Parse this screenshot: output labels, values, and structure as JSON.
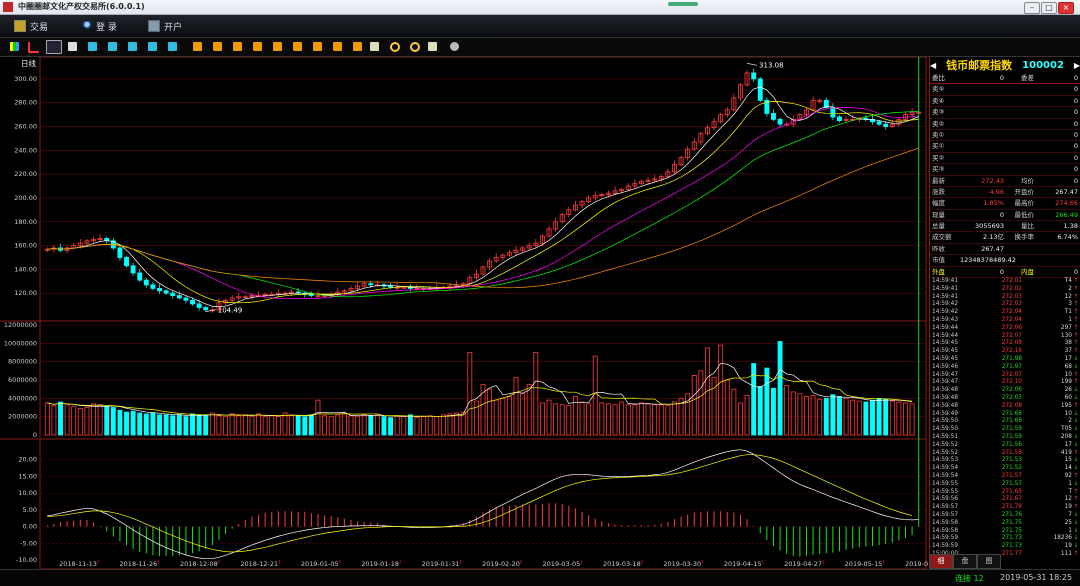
{
  "window": {
    "title": "中圈圈邮文化产权交易所(6.0.0.1)"
  },
  "menu": {
    "items": [
      {
        "label": "交易"
      },
      {
        "label": "登 录"
      },
      {
        "label": "开户"
      }
    ]
  },
  "chart": {
    "period_label": "日线",
    "price_y_ticks": [
      "300.00",
      "280.00",
      "260.00",
      "240.00",
      "220.00",
      "200.00",
      "180.00",
      "160.00",
      "140.00",
      "120.00"
    ],
    "volume_y_ticks": [
      "12000000",
      "10000000",
      "8000000",
      "6000000",
      "4000000",
      "2000000",
      "0"
    ],
    "macd_y_ticks": [
      "20.00",
      "15.00",
      "10.00",
      "5.00",
      "0.00",
      "-5.00",
      "-10.00"
    ],
    "x_dates": [
      "2018-11-13",
      "2018-11-26",
      "2018-12-08",
      "2018-12-21",
      "2019-01-05",
      "2019-01-18",
      "2019-01-31",
      "2019-02-20",
      "2019-03-05",
      "2019-03-18",
      "2019-03-30",
      "2019-04-15",
      "2019-04-27",
      "2019-05-15",
      "2019-05-31"
    ],
    "max_label": "313.08",
    "min_label": "104.49"
  },
  "chart_data": {
    "type": "candlestick",
    "price_ylim": [
      100,
      310
    ],
    "volume_ylim": [
      0,
      12000000
    ],
    "macd_ylim": [
      -10,
      25
    ],
    "max_price": 313.08,
    "min_price": 104.49,
    "close_series": [
      157,
      158,
      156,
      158,
      160,
      162,
      164,
      165,
      166,
      164,
      158,
      150,
      143,
      137,
      131,
      127,
      124,
      122,
      120,
      118,
      116,
      114,
      111,
      108,
      106,
      106,
      112,
      114,
      116,
      117,
      117,
      118,
      118,
      119,
      119,
      120,
      120,
      121,
      120,
      119,
      118,
      118,
      118,
      119,
      121,
      122,
      124,
      126,
      128,
      127,
      127,
      126,
      125,
      125,
      125,
      124,
      124,
      124,
      124,
      125,
      125,
      126,
      127,
      128,
      133,
      136,
      142,
      147,
      150,
      152,
      154,
      156,
      158,
      160,
      162,
      168,
      174,
      180,
      186,
      190,
      194,
      197,
      200,
      202,
      203,
      204,
      206,
      207,
      210,
      212,
      214,
      215,
      216,
      218,
      222,
      228,
      234,
      241,
      247,
      254,
      259,
      264,
      270,
      274,
      284,
      295,
      305,
      300,
      282,
      271,
      266,
      262,
      262,
      266,
      270,
      274,
      282,
      282,
      276,
      268,
      265,
      266,
      266,
      267,
      266,
      264,
      262,
      260,
      262,
      266,
      270,
      272,
      272
    ],
    "volume_series": [
      3500000,
      3200000,
      3600000,
      3300000,
      3100000,
      2900000,
      3000000,
      3400000,
      3300000,
      3100000,
      3000000,
      2700000,
      2500000,
      2600000,
      2400000,
      2300000,
      2400000,
      2200000,
      2200000,
      2100000,
      2200000,
      2000000,
      2300000,
      2100000,
      2200000,
      2400000,
      2100000,
      2000000,
      2300000,
      2100000,
      2200000,
      2000000,
      2300000,
      2000000,
      2100000,
      2000000,
      2400000,
      2200000,
      2100000,
      2000000,
      2200000,
      3800000,
      2100000,
      2000000,
      2200000,
      2300000,
      2100000,
      2000000,
      2200000,
      2100000,
      2200000,
      2000000,
      1900000,
      2100000,
      2000000,
      2200000,
      1900000,
      2000000,
      2100000,
      2000000,
      2200000,
      2300000,
      2400000,
      2500000,
      9000000,
      3700000,
      5500000,
      5000000,
      3800000,
      4000000,
      4200000,
      6300000,
      4500000,
      5500000,
      9000000,
      3500000,
      3800000,
      3400000,
      3300000,
      3200000,
      4200000,
      3600000,
      3400000,
      8600000,
      3500000,
      3400000,
      3300000,
      3600000,
      3300000,
      3300000,
      3500000,
      3400000,
      3300000,
      3300000,
      3200000,
      3600000,
      4000000,
      4500000,
      6500000,
      7000000,
      9500000,
      6300000,
      9800000,
      6000000,
      5000000,
      3500000,
      4300000,
      7800000,
      5300000,
      7300000,
      5100000,
      10200000,
      5400000,
      4700000,
      4500000,
      4200000,
      4300000,
      3900000,
      4000000,
      4400000,
      4200000,
      4000000,
      3800000,
      3700000,
      3600000,
      3800000,
      4000000,
      3900000,
      3700000,
      3600000,
      3500000,
      3400000
    ],
    "macd_dif": [
      3.2,
      3.5,
      4.0,
      4.4,
      4.8,
      5.2,
      5.5,
      5.3,
      4.6,
      3.8,
      2.7,
      1.5,
      0.3,
      -1.0,
      -2.2,
      -3.3,
      -4.4,
      -5.4,
      -6.3,
      -7.1,
      -7.8,
      -8.5,
      -9.0,
      -9.4,
      -9.6,
      -9.6,
      -9.2,
      -8.6,
      -7.9,
      -7.1,
      -6.3,
      -5.5,
      -4.8,
      -4.1,
      -3.5,
      -2.9,
      -2.4,
      -1.9,
      -1.5,
      -1.1,
      -0.8,
      -0.5,
      -0.3,
      -0.1,
      0.0,
      0.1,
      0.2,
      0.2,
      0.3,
      0.3,
      0.3,
      0.2,
      0.1,
      0.0,
      -0.1,
      -0.2,
      -0.3,
      -0.3,
      -0.3,
      -0.2,
      -0.1,
      0.1,
      0.3,
      0.6,
      1.3,
      2.2,
      3.3,
      4.5,
      5.6,
      6.6,
      7.6,
      8.6,
      9.6,
      10.5,
      11.4,
      12.4,
      13.4,
      14.3,
      15.0,
      15.4,
      15.6,
      15.6,
      15.5,
      15.3,
      15.1,
      15.0,
      14.9,
      14.9,
      15.0,
      15.1,
      15.2,
      15.3,
      15.5,
      15.7,
      16.2,
      16.9,
      17.7,
      18.5,
      19.3,
      20.0,
      20.7,
      21.3,
      21.9,
      22.4,
      22.8,
      23.0,
      22.6,
      21.6,
      20.3,
      18.9,
      17.5,
      16.1,
      14.8,
      13.6,
      12.6,
      11.8,
      11.1,
      10.3,
      9.5,
      8.7,
      8.0,
      7.3,
      6.6,
      5.9,
      5.2,
      4.5,
      3.8,
      3.2,
      2.7,
      2.3,
      2.1,
      2.0,
      2.1
    ],
    "macd_dea": [
      3.0,
      3.1,
      3.3,
      3.6,
      3.9,
      4.2,
      4.5,
      4.7,
      4.7,
      4.5,
      4.2,
      3.7,
      3.1,
      2.4,
      1.6,
      0.7,
      -0.1,
      -1.0,
      -1.9,
      -2.7,
      -3.5,
      -4.3,
      -5.0,
      -5.7,
      -6.3,
      -6.8,
      -7.2,
      -7.5,
      -7.6,
      -7.5,
      -7.3,
      -7.0,
      -6.6,
      -6.2,
      -5.7,
      -5.2,
      -4.7,
      -4.2,
      -3.7,
      -3.3,
      -2.8,
      -2.4,
      -2.0,
      -1.7,
      -1.4,
      -1.1,
      -0.8,
      -0.6,
      -0.4,
      -0.3,
      -0.2,
      -0.1,
      0.0,
      0.0,
      0.0,
      0.0,
      -0.1,
      -0.1,
      -0.1,
      -0.1,
      -0.1,
      -0.1,
      0.0,
      0.1,
      0.3,
      0.7,
      1.2,
      1.9,
      2.7,
      3.6,
      4.5,
      5.4,
      6.3,
      7.2,
      8.1,
      9.0,
      9.9,
      10.8,
      11.6,
      12.3,
      12.9,
      13.4,
      13.8,
      14.1,
      14.3,
      14.5,
      14.6,
      14.7,
      14.8,
      14.9,
      15.0,
      15.1,
      15.2,
      15.3,
      15.5,
      15.8,
      16.2,
      16.7,
      17.2,
      17.8,
      18.4,
      19.0,
      19.6,
      20.2,
      20.7,
      21.2,
      21.5,
      21.5,
      21.3,
      20.9,
      20.4,
      19.7,
      18.9,
      18.0,
      17.1,
      16.2,
      15.3,
      14.4,
      13.5,
      12.6,
      11.7,
      10.8,
      9.9,
      9.0,
      8.2,
      7.4,
      6.6,
      5.8,
      5.1,
      4.4,
      3.8,
      3.3
    ]
  },
  "quote": {
    "name": "钱币邮票指数",
    "code": "100002",
    "order_book": [
      {
        "l1": "委比",
        "v1": "0",
        "l2": "委差",
        "v2": "0"
      },
      {
        "l1": "卖⑤",
        "v1": "",
        "l2": "",
        "v2": "0"
      },
      {
        "l1": "卖④",
        "v1": "",
        "l2": "",
        "v2": "0"
      },
      {
        "l1": "卖③",
        "v1": "",
        "l2": "",
        "v2": "0"
      },
      {
        "l1": "卖②",
        "v1": "",
        "l2": "",
        "v2": "0"
      },
      {
        "l1": "卖①",
        "v1": "",
        "l2": "",
        "v2": "0"
      },
      {
        "l1": "买①",
        "v1": "",
        "l2": "",
        "v2": "0"
      },
      {
        "l1": "买②",
        "v1": "",
        "l2": "",
        "v2": "0"
      },
      {
        "l1": "买③",
        "v1": "",
        "l2": "",
        "v2": "0"
      }
    ],
    "stats": [
      {
        "l1": "最新",
        "v1": "272.43",
        "c1": "red",
        "l2": "均价",
        "v2": "0",
        "c2": "white"
      },
      {
        "l1": "涨跌",
        "v1": "4.96",
        "c1": "red",
        "l2": "开盘价",
        "v2": "267.47",
        "c2": "white"
      },
      {
        "l1": "幅度",
        "v1": "1.85%",
        "c1": "red",
        "l2": "最高价",
        "v2": "274.66",
        "c2": "red"
      },
      {
        "l1": "现量",
        "v1": "0",
        "c1": "white",
        "l2": "最低价",
        "v2": "266.49",
        "c2": "green"
      },
      {
        "l1": "总量",
        "v1": "3055693",
        "c1": "white",
        "l2": "量比",
        "v2": "1.38",
        "c2": "white"
      },
      {
        "l1": "成交额",
        "v1": "2.13亿",
        "c1": "white",
        "l2": "换手率",
        "v2": "6.74%",
        "c2": "white"
      },
      {
        "l1": "昨收",
        "v1": "267.47",
        "c1": "white",
        "l2": "",
        "v2": "",
        "c2": "white"
      },
      {
        "l1": "市值",
        "v1": "12348378489.42",
        "c1": "white",
        "l2": "",
        "v2": "",
        "c2": "white"
      }
    ],
    "outer_label": "外盘",
    "outer_value": "0",
    "inner_label": "内盘",
    "inner_value": "0"
  },
  "ticks": [
    {
      "t": "14:59:41",
      "p": "272.01",
      "v": "T4",
      "d": "up"
    },
    {
      "t": "14:59:41",
      "p": "272.02",
      "v": "2",
      "d": "up"
    },
    {
      "t": "14:59:41",
      "p": "272.03",
      "v": "12",
      "d": "up"
    },
    {
      "t": "14:59:42",
      "p": "272.03",
      "v": "3",
      "d": "up"
    },
    {
      "t": "14:59:42",
      "p": "272.04",
      "v": "T1",
      "d": "up"
    },
    {
      "t": "14:59:43",
      "p": "272.04",
      "v": "1",
      "d": "up"
    },
    {
      "t": "14:59:44",
      "p": "272.06",
      "v": "297",
      "d": "up"
    },
    {
      "t": "14:59:44",
      "p": "272.07",
      "v": "130",
      "d": "up"
    },
    {
      "t": "14:59:45",
      "p": "272.08",
      "v": "38",
      "d": "up"
    },
    {
      "t": "14:59:45",
      "p": "272.16",
      "v": "37",
      "d": "up"
    },
    {
      "t": "14:59:45",
      "p": "271.98",
      "v": "17",
      "d": "down"
    },
    {
      "t": "14:59:46",
      "p": "271.97",
      "v": "68",
      "d": "down"
    },
    {
      "t": "14:59:47",
      "p": "272.07",
      "v": "10",
      "d": "up"
    },
    {
      "t": "14:59:47",
      "p": "272.10",
      "v": "199",
      "d": "up"
    },
    {
      "t": "14:59:48",
      "p": "272.06",
      "v": "26",
      "d": "down"
    },
    {
      "t": "14:59:48",
      "p": "272.03",
      "v": "60",
      "d": "down"
    },
    {
      "t": "14:59:48",
      "p": "272.08",
      "v": "195",
      "d": "up"
    },
    {
      "t": "14:59:49",
      "p": "271.68",
      "v": "10",
      "d": "down"
    },
    {
      "t": "14:59:50",
      "p": "271.68",
      "v": "2",
      "d": "down"
    },
    {
      "t": "14:59:50",
      "p": "271.59",
      "v": "T05",
      "d": "down"
    },
    {
      "t": "14:59:51",
      "p": "271.59",
      "v": "208",
      "d": "down"
    },
    {
      "t": "14:59:52",
      "p": "271.56",
      "v": "17",
      "d": "down"
    },
    {
      "t": "14:59:52",
      "p": "271.58",
      "v": "419",
      "d": "up"
    },
    {
      "t": "14:59:53",
      "p": "271.53",
      "v": "15",
      "d": "down"
    },
    {
      "t": "14:59:54",
      "p": "271.52",
      "v": "14",
      "d": "down"
    },
    {
      "t": "14:59:54",
      "p": "271.57",
      "v": "92",
      "d": "up"
    },
    {
      "t": "14:59:55",
      "p": "271.57",
      "v": "1",
      "d": "down"
    },
    {
      "t": "14:59:55",
      "p": "271.65",
      "v": "T",
      "d": "up"
    },
    {
      "t": "14:59:56",
      "p": "271.67",
      "v": "12",
      "d": "up"
    },
    {
      "t": "14:59:57",
      "p": "271.78",
      "v": "19",
      "d": "up"
    },
    {
      "t": "14:59:57",
      "p": "271.76",
      "v": "7",
      "d": "down"
    },
    {
      "t": "14:59:58",
      "p": "271.75",
      "v": "25",
      "d": "down"
    },
    {
      "t": "14:59:58",
      "p": "271.75",
      "v": "1",
      "d": "down"
    },
    {
      "t": "14:59:59",
      "p": "271.73",
      "v": "18236",
      "d": "down"
    },
    {
      "t": "14:59:59",
      "p": "271.73",
      "v": "19",
      "d": "down"
    },
    {
      "t": "15:00:00",
      "p": "271.77",
      "v": "111",
      "d": "up"
    }
  ],
  "tabs": [
    {
      "label": "细"
    },
    {
      "label": "盘"
    },
    {
      "label": "图"
    }
  ],
  "status": {
    "connection": "连接 12",
    "datetime": "2019-05-31 18:25"
  },
  "colors": {
    "up": "#ff3b3b",
    "down": "#00ffff",
    "ma5": "#ffffff",
    "ma10": "#ffff00",
    "ma20": "#ff00ff",
    "ma30": "#00ff00",
    "ma60": "#ff8c00",
    "grid": "#5a0a0a"
  }
}
